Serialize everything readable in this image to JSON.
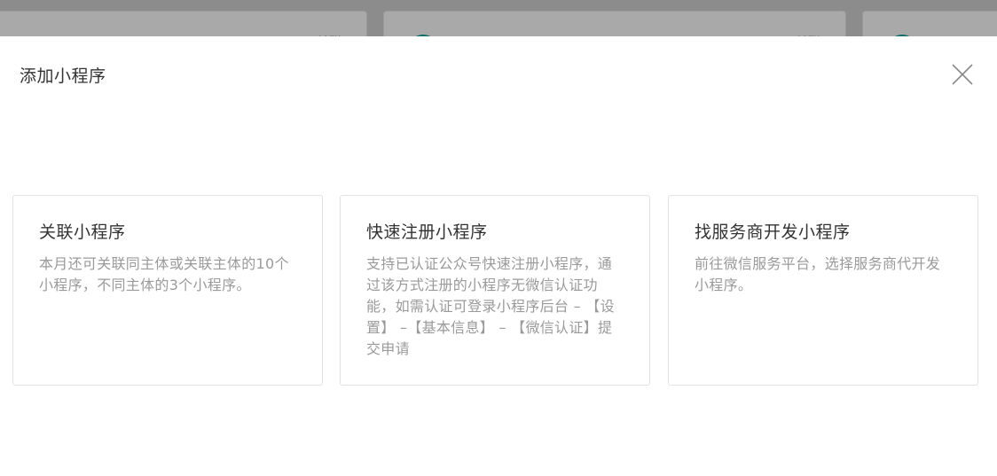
{
  "background": {
    "card1_label": "已关联",
    "card2_label": "已关联"
  },
  "modal": {
    "title": "添加小程序",
    "close_icon": "close-icon",
    "options": [
      {
        "title": "关联小程序",
        "desc": "本月还可关联同主体或关联主体的10个小程序，不同主体的3个小程序。"
      },
      {
        "title": "快速注册小程序",
        "desc": "支持已认证公众号快速注册小程序，通过该方式注册的小程序无微信认证功能，如需认证可登录小程序后台 – 【设置】 –【基本信息】 – 【微信认证】提交申请"
      },
      {
        "title": "找服务商开发小程序",
        "desc": "前往微信服务平台，选择服务商代开发小程序。"
      }
    ]
  },
  "colors": {
    "overlay": "#8c8c8c",
    "modal_bg": "#ffffff",
    "title_text": "#333333",
    "desc_text": "#9a9a9a",
    "card_border": "#e2e2e2",
    "avatar": "#0e6b6b"
  }
}
